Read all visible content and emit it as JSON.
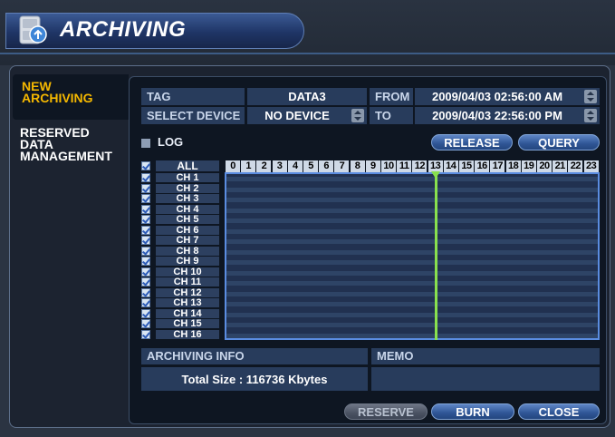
{
  "window": {
    "title": "ARCHIVING"
  },
  "tabs": {
    "active_line1": "NEW",
    "active_line2": "ARCHIVING",
    "reserved_line1": "RESERVED",
    "reserved_line2": "DATA",
    "reserved_line3": "MANAGEMENT"
  },
  "fields": {
    "tag_label": "TAG",
    "tag_value": "DATA3",
    "device_label": "SELECT DEVICE",
    "device_value": "NO DEVICE",
    "from_label": "FROM",
    "from_value": "2009/04/03 02:56:00 AM",
    "to_label": "TO",
    "to_value": "2009/04/03 22:56:00 PM"
  },
  "log_label": "LOG",
  "buttons": {
    "release": "RELEASE",
    "query": "QUERY",
    "reserve": "RESERVE",
    "burn": "BURN",
    "close": "CLOSE"
  },
  "timeline": {
    "all_label": "ALL",
    "hours": [
      "0",
      "1",
      "2",
      "3",
      "4",
      "5",
      "6",
      "7",
      "8",
      "9",
      "10",
      "11",
      "12",
      "13",
      "14",
      "15",
      "16",
      "17",
      "18",
      "19",
      "20",
      "21",
      "22",
      "23"
    ],
    "channels": [
      "CH 1",
      "CH 2",
      "CH 3",
      "CH 4",
      "CH 5",
      "CH 6",
      "CH 7",
      "CH 8",
      "CH 9",
      "CH 10",
      "CH 11",
      "CH 12",
      "CH 13",
      "CH 14",
      "CH 15",
      "CH 16"
    ],
    "marker_hour": 13,
    "marker_color": "#88e04e"
  },
  "info": {
    "header": "ARCHIVING INFO",
    "total_size": "Total Size : 116736 Kbytes",
    "memo_header": "MEMO",
    "memo_value": ""
  },
  "colors": {
    "accent_tab": "#f5b800",
    "button_blue": "#2f5595"
  }
}
